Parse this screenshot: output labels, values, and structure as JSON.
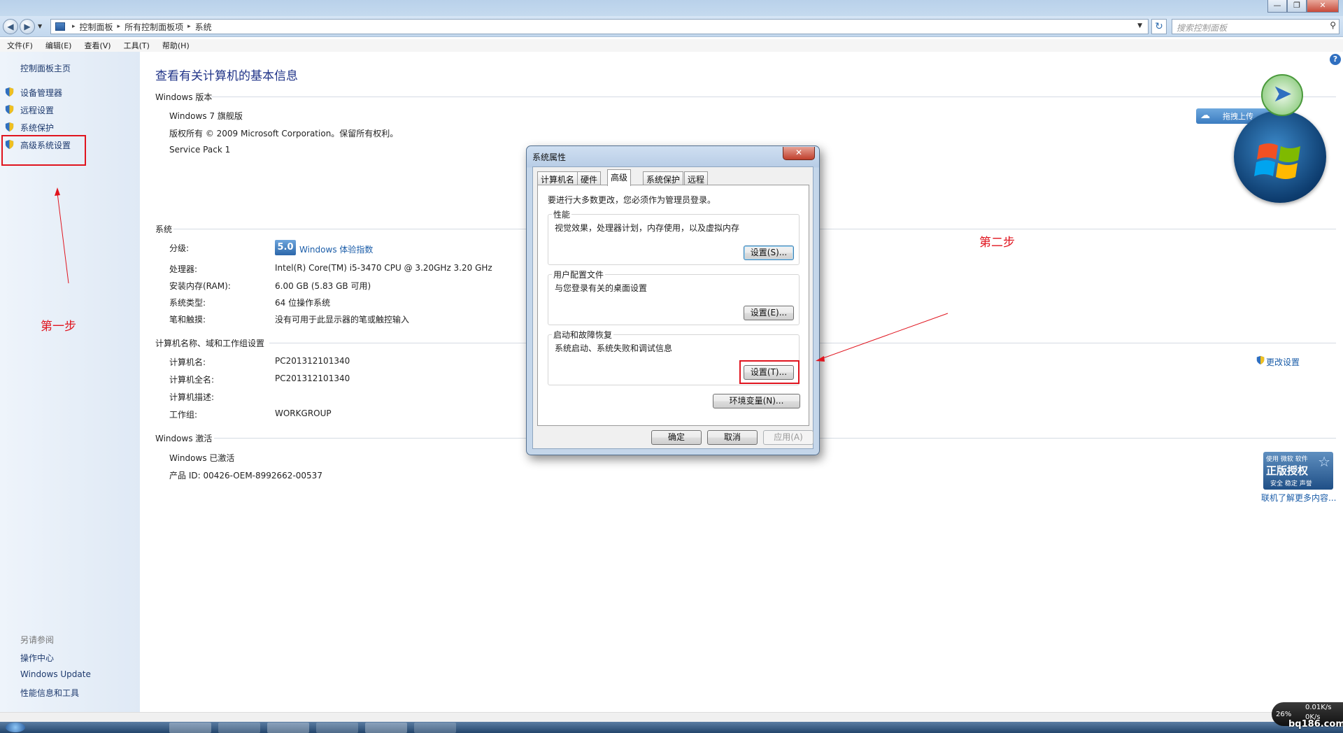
{
  "window": {
    "minimize": "—",
    "maximize": "❐",
    "close": "✕"
  },
  "address": {
    "crumbs": [
      "控制面板",
      "所有控制面板项",
      "系统"
    ],
    "search_placeholder": "搜索控制面板"
  },
  "menu": [
    "文件(F)",
    "编辑(E)",
    "查看(V)",
    "工具(T)",
    "帮助(H)"
  ],
  "left_pane": {
    "home": "控制面板主页",
    "items": [
      "设备管理器",
      "远程设置",
      "系统保护",
      "高级系统设置"
    ],
    "see_also_title": "另请参阅",
    "see_also": [
      "操作中心",
      "Windows Update",
      "性能信息和工具"
    ]
  },
  "main": {
    "title": "查看有关计算机的基本信息",
    "edition_section": "Windows 版本",
    "edition": "Windows 7 旗舰版",
    "copyright": "版权所有 © 2009 Microsoft Corporation。保留所有权利。",
    "service_pack": "Service Pack 1",
    "system_section": "系统",
    "rating_label": "分级:",
    "rating_score": "5.0",
    "rating_link": "Windows 体验指数",
    "processor_label": "处理器:",
    "processor": "Intel(R) Core(TM) i5-3470 CPU @ 3.20GHz   3.20 GHz",
    "ram_label": "安装内存(RAM):",
    "ram": "6.00 GB (5.83 GB 可用)",
    "systype_label": "系统类型:",
    "systype": "64 位操作系统",
    "pen_label": "笔和触摸:",
    "pen": "没有可用于此显示器的笔或触控输入",
    "computer_section": "计算机名称、域和工作组设置",
    "compname_label": "计算机名:",
    "compname": "PC201312101340",
    "fullname_label": "计算机全名:",
    "fullname": "PC201312101340",
    "desc_label": "计算机描述:",
    "workgroup_label": "工作组:",
    "workgroup": "WORKGROUP",
    "change_settings": "更改设置",
    "activation_section": "Windows 激活",
    "activated": "Windows 已激活",
    "product_id": "产品 ID: 00426-OEM-8992662-00537",
    "upload_button": "拖拽上传",
    "genuine_top": "使用 微软 软件",
    "genuine_main": "正版授权",
    "genuine_bottom": "安全 稳定 声誉",
    "genuine_link": "联机了解更多内容..."
  },
  "dialog": {
    "title": "系统属性",
    "tabs": [
      "计算机名",
      "硬件",
      "高级",
      "系统保护",
      "远程"
    ],
    "admin_note": "要进行大多数更改，您必须作为管理员登录。",
    "perf_title": "性能",
    "perf_desc": "视觉效果，处理器计划，内存使用，以及虚拟内存",
    "perf_button": "设置(S)...",
    "profile_title": "用户配置文件",
    "profile_desc": "与您登录有关的桌面设置",
    "profile_button": "设置(E)...",
    "startup_title": "启动和故障恢复",
    "startup_desc": "系统启动、系统失败和调试信息",
    "startup_button": "设置(T)...",
    "env_button": "环境变量(N)...",
    "ok": "确定",
    "cancel": "取消",
    "apply": "应用(A)"
  },
  "annotations": {
    "step1": "第一步",
    "step2": "第二步"
  },
  "tray": {
    "cpu": "26%",
    "up": "0.01K/s",
    "down": "0K/s",
    "watermark": "bq186.com"
  },
  "colors": {
    "annotation_red": "#e0141e",
    "link_blue": "#1a5ca8"
  }
}
